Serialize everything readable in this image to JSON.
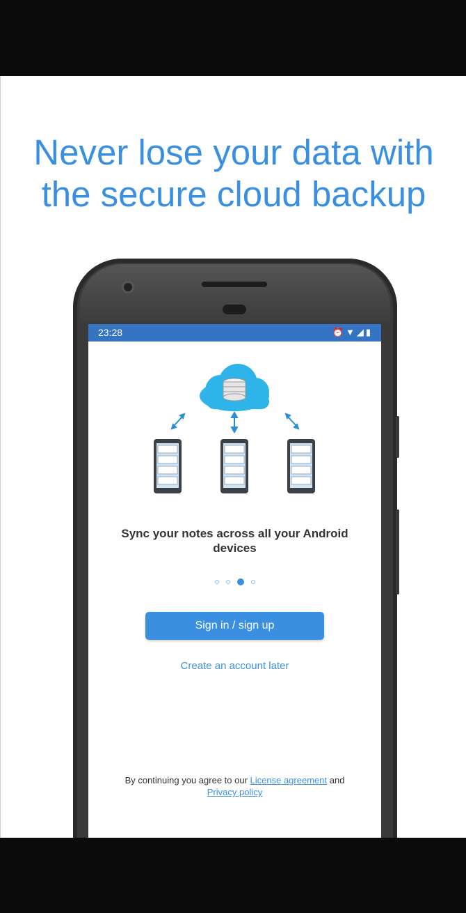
{
  "headline": {
    "line1": "Never lose your data with",
    "line2": "the secure cloud backup"
  },
  "statusbar": {
    "time": "23:28",
    "icons": [
      "alarm-icon",
      "wifi-icon",
      "signal-icon",
      "battery-icon"
    ]
  },
  "onboarding": {
    "message": "Sync your notes across all your Android devices",
    "page_indicator": {
      "total": 4,
      "active": 3
    }
  },
  "actions": {
    "signin_label": "Sign in / sign up",
    "later_label": "Create an account later"
  },
  "terms": {
    "prefix": "By continuing you agree to our",
    "license_link": "License agreement",
    "conjunction": "and",
    "privacy_link": "Privacy policy"
  },
  "colors": {
    "accent": "#3a8fe0",
    "statusbar": "#3474c3",
    "cloud": "#2fb4ea"
  }
}
